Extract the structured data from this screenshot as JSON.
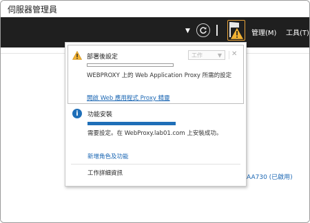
{
  "window": {
    "title": "伺服器管理員"
  },
  "header": {
    "manage_menu": "管理(M)",
    "tools_menu": "工具(T)"
  },
  "colors": {
    "accent": "#1f6fb8",
    "warning": "#f2b233",
    "header_bg": "#1f1f1f"
  },
  "notifications": [
    {
      "icon": "warning-icon",
      "title": "部署後設定",
      "tasks_button": "工作",
      "progress": 0,
      "message": "WEBPROXY 上的 Web Application Proxy 所需的設定",
      "link": "開啟 Web 應用程式 Proxy 精靈"
    },
    {
      "icon": "info-icon",
      "title": "功能安裝",
      "progress": 1,
      "message": "需要設定。在 WebProxy.lab01.com 上安裝成功。"
    }
  ],
  "links": {
    "add_roles": "新增角色及功能",
    "task_details": "工作詳細資訊"
  },
  "background": {
    "server_status": "-AA730 (已啟用)"
  }
}
